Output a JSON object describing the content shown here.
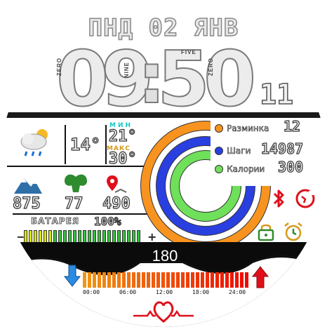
{
  "date": "ПНД 02 ЯНВ",
  "time": {
    "hour_tens": "0",
    "hour_ones": "9",
    "minute_tens": "5",
    "minute_ones": "0",
    "colon": ":",
    "seconds": "11",
    "labels": {
      "hour_tens": "ZERO",
      "hour_ones": "NINE",
      "minute_tens": "FIVE",
      "minute_ones": "ZERO"
    }
  },
  "weather": {
    "temperature": "14°",
    "min_label": "МИН",
    "min_value": "21°",
    "max_label": "МАКС",
    "max_value": "30°",
    "icon": "cloud-sun-rain-icon"
  },
  "stats": {
    "altitude": "875",
    "calories_burn": "77",
    "distance": "490",
    "altitude_icon": "mountain-icon",
    "fitness_icon": "muscle-icon",
    "location_icon": "map-pin-icon"
  },
  "battery": {
    "label": "БАТАРЕЯ",
    "percent_text": "100%",
    "level": 1.0,
    "minus": "−",
    "plus": "+"
  },
  "rings": {
    "items": [
      {
        "label": "Разминка",
        "value": "12",
        "color": "#f7931e",
        "fill": 0.78
      },
      {
        "label": "Шаги",
        "value": "14987",
        "color": "#2a3fe0",
        "fill": 0.78
      },
      {
        "label": "Калории",
        "value": "300",
        "color": "#6fe05a",
        "fill": 0.78
      }
    ]
  },
  "status_icons": [
    "bluetooth-icon",
    "do-not-disturb-icon",
    "lock-icon",
    "alarm-icon"
  ],
  "heart": {
    "value": "180",
    "ticks": [
      "00:00",
      "06:00",
      "12:00",
      "18:00",
      "24:00"
    ],
    "down_icon": "arrow-down-icon",
    "up_icon": "arrow-up-icon",
    "icon": "heart-pulse-icon"
  },
  "colors": {
    "orange": "#f7931e",
    "blue": "#2a3fe0",
    "green": "#6fe05a",
    "red": "#e0101a",
    "teal": "#18c7c9",
    "gold": "#d49a1a"
  }
}
